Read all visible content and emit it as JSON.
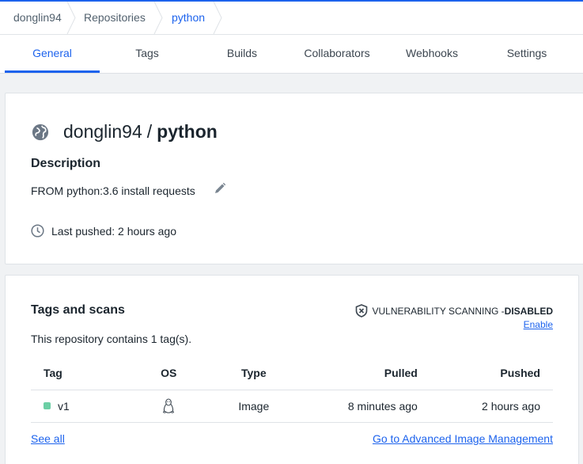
{
  "breadcrumb": {
    "items": [
      "donglin94",
      "Repositories",
      "python"
    ]
  },
  "tabs": [
    "General",
    "Tags",
    "Builds",
    "Collaborators",
    "Webhooks",
    "Settings"
  ],
  "active_tab": "General",
  "repo": {
    "namespace": "donglin94",
    "separator": "/",
    "name": "python",
    "visibility_icon": "globe-icon"
  },
  "description": {
    "heading": "Description",
    "text": "FROM python:3.6 install requests",
    "edit_icon": "pencil-icon"
  },
  "last_pushed": {
    "label": "Last pushed: 2 hours ago",
    "icon": "clock-icon"
  },
  "tags_section": {
    "heading": "Tags and scans",
    "vuln_label": "VULNERABILITY SCANNING - ",
    "vuln_state": "DISABLED",
    "vuln_icon": "shield-x-icon",
    "enable_label": "Enable",
    "count_text": "This repository contains 1 tag(s).",
    "columns": {
      "tag": "Tag",
      "os": "OS",
      "type": "Type",
      "pulled": "Pulled",
      "pushed": "Pushed"
    },
    "rows": [
      {
        "tag": "v1",
        "os_icon": "linux-tux-icon",
        "type": "Image",
        "pulled": "8 minutes ago",
        "pushed": "2 hours ago"
      }
    ],
    "see_all": "See all",
    "advanced_link": "Go to Advanced Image Management"
  },
  "colors": {
    "accent": "#1d63ed",
    "tag_status": "#6ccfa5"
  }
}
